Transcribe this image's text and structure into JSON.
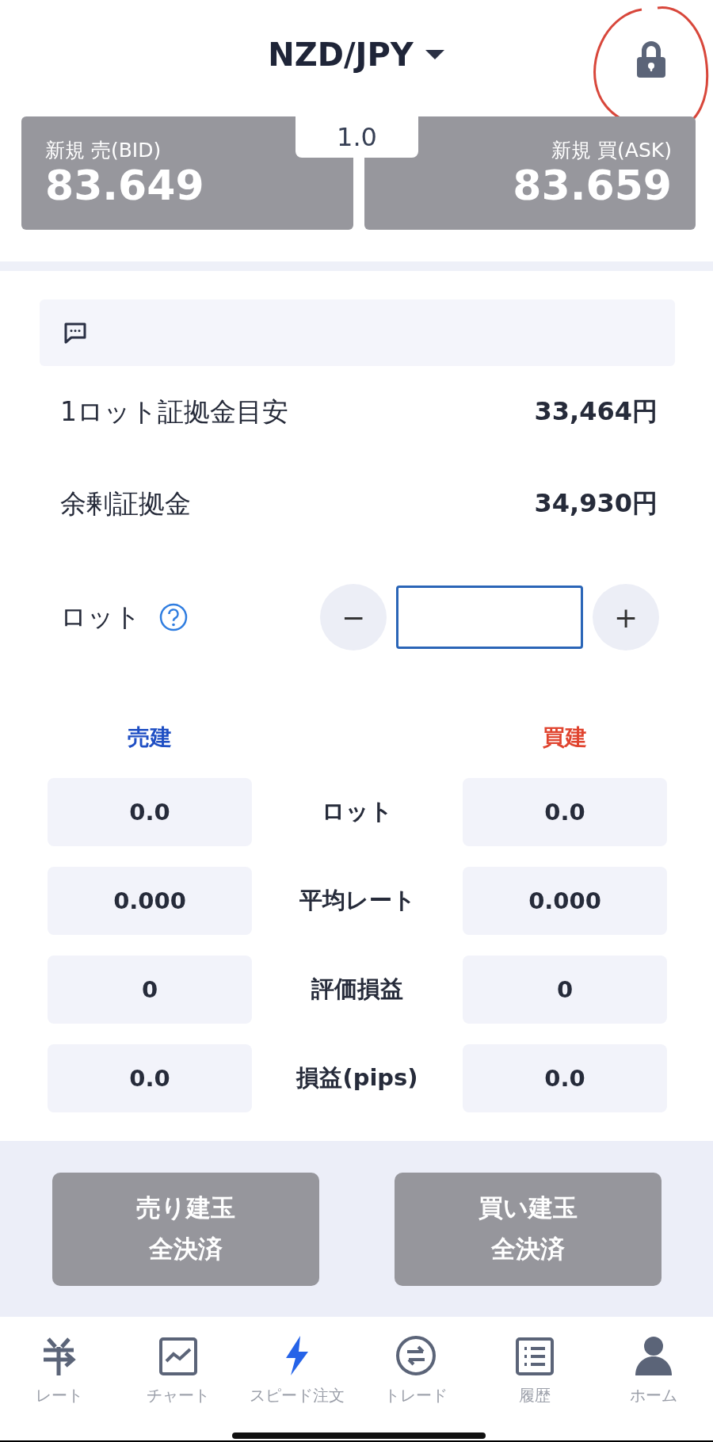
{
  "header": {
    "title": "NZD/JPY"
  },
  "quote": {
    "bid_label": "新規 売(BID)",
    "bid": "83.649",
    "spread": "1.0",
    "ask_label": "新規 買(ASK)",
    "ask": "83.659"
  },
  "info_rows": [
    {
      "label": "1ロット証拠金目安",
      "value": "33,464円"
    },
    {
      "label": "余剰証拠金",
      "value": "34,930円"
    }
  ],
  "lot": {
    "label": "ロット",
    "minus": "−",
    "plus": "+"
  },
  "positions": {
    "sell_header": "売建",
    "buy_header": "買建",
    "rows": [
      {
        "sell": "0.0",
        "label": "ロット",
        "buy": "0.0"
      },
      {
        "sell": "0.000",
        "label": "平均レート",
        "buy": "0.000"
      },
      {
        "sell": "0",
        "label": "評価損益",
        "buy": "0"
      },
      {
        "sell": "0.0",
        "label": "損益(pips)",
        "buy": "0.0"
      }
    ]
  },
  "actions": [
    {
      "line1": "売り建玉",
      "line2": "全決済"
    },
    {
      "line1": "買い建玉",
      "line2": "全決済"
    }
  ],
  "nav": [
    {
      "kind": "rate",
      "label": "レート",
      "selected": false
    },
    {
      "kind": "chart",
      "label": "チャート",
      "selected": false
    },
    {
      "kind": "speed",
      "label": "スピード注文",
      "selected": true
    },
    {
      "kind": "trade",
      "label": "トレード",
      "selected": false
    },
    {
      "kind": "history",
      "label": "履歴",
      "selected": false
    },
    {
      "kind": "home",
      "label": "ホーム",
      "selected": false
    }
  ]
}
